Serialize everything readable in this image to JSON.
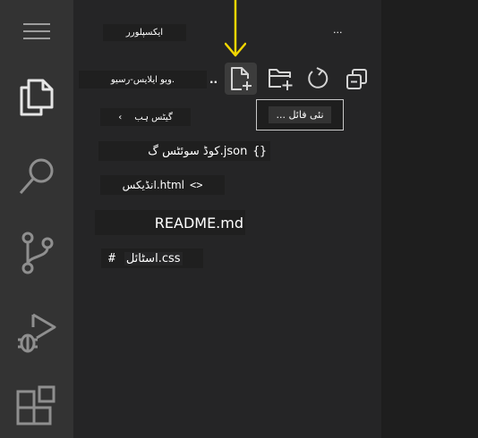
{
  "activity_bar": {
    "items": [
      {
        "name": "menu",
        "icon": "hamburger-menu-icon"
      },
      {
        "name": "explorer",
        "icon": "files-icon",
        "active": true
      },
      {
        "name": "search",
        "icon": "search-icon"
      },
      {
        "name": "source-control",
        "icon": "source-control-icon"
      },
      {
        "name": "run-debug",
        "icon": "run-debug-icon"
      },
      {
        "name": "extensions",
        "icon": "extensions-icon"
      }
    ]
  },
  "sidebar": {
    "title": "ایکسپلورر",
    "more_actions": "...",
    "section_title": "ویو ایلایس-رسیو.",
    "section_more": "..",
    "toolbar": {
      "new_file_icon": "new-file-icon",
      "new_folder_icon": "new-folder-icon",
      "refresh_icon": "refresh-icon",
      "collapse_icon": "collapse-all-icon"
    },
    "tooltip": "... نئی فائل",
    "folder": {
      "chevron": "‹",
      "label": "گیٹس ہب"
    },
    "files": [
      {
        "icon": "{}",
        "label": "کوڈ سوئٹس گ.json"
      },
      {
        "icon": "<>",
        "label": "انڈیکس.html"
      },
      {
        "icon": "",
        "label": "README.md"
      },
      {
        "icon": "#",
        "label": "اسٹائل.css"
      }
    ]
  },
  "accent_colors": {
    "arrow": "#f2d600",
    "tooltip_border": "#c8c8c8"
  }
}
